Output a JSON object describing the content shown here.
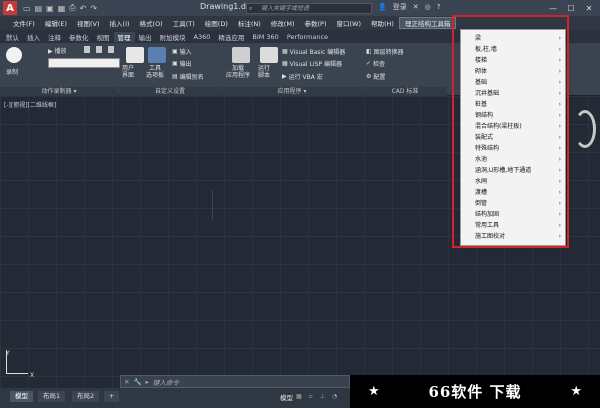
{
  "app": {
    "logo": "A",
    "doc_title": "Drawing1.dwg",
    "search_placeholder": "键入关键字或短语",
    "signin": "登录",
    "window_buttons": [
      "—",
      "☐",
      "✕"
    ]
  },
  "menubar": {
    "items": [
      "文件(F)",
      "编辑(E)",
      "视图(V)",
      "插入(I)",
      "格式(O)",
      "工具(T)",
      "绘图(D)",
      "标注(N)",
      "修改(M)",
      "参数(P)",
      "窗口(W)",
      "帮助(H)",
      "理正结构工具箱"
    ]
  },
  "ribbon_tabs": [
    "默认",
    "插入",
    "注释",
    "参数化",
    "视图",
    "管理",
    "输出",
    "附加模块",
    "A360",
    "精选应用",
    "BIM 360",
    "Performance"
  ],
  "ribbon": {
    "record": "录制",
    "play": "▶ 播放",
    "cui": "用户\n界面",
    "tool_palette": "工具\n选项板",
    "import": "输入",
    "export": "输出",
    "edit_alias": "编辑别名",
    "load_app": "加载\n应用程序",
    "run_script": "运行\n脚本",
    "vba_editor": "Visual Basic 编辑器",
    "lisp_editor": "Visual LISP 编辑器",
    "run_vba": "运行 VBA 宏",
    "layer_translator": "图层转换器",
    "check": "检查",
    "configure": "配置",
    "panels": [
      "动作录制器 ▾",
      "自定义设置",
      "应用程序 ▾",
      "CAD 标准"
    ]
  },
  "canvas": {
    "view_label": "[-][俯视][二维线框]",
    "ucs_y": "Y",
    "ucs_x": "X"
  },
  "cmdline": {
    "placeholder": "键入命令"
  },
  "layout_tabs": [
    "模型",
    "布局1",
    "布局2",
    "+"
  ],
  "status": {
    "model": "模型"
  },
  "dropdown": {
    "items": [
      "梁",
      "板,柱,墙",
      "楼梯",
      "砌体",
      "基础",
      "沉井基础",
      "桩基",
      "钢结构",
      "混合结构(梁柱板)",
      "装配式",
      "特殊结构",
      "水池",
      "涵洞,U形槽,地下通道",
      "水闸",
      "渡槽",
      "倒管",
      "结构加固",
      "常用工具",
      "施工图校对"
    ]
  },
  "watermark": {
    "text": "66软件 下载",
    "star": "★"
  }
}
